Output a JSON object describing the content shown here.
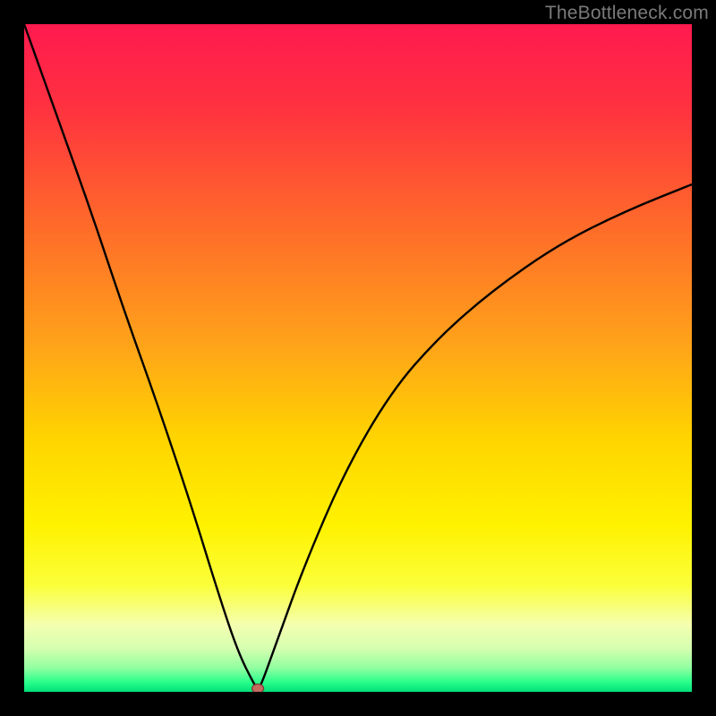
{
  "watermark": "TheBottleneck.com",
  "chart_data": {
    "type": "line",
    "title": "",
    "xlabel": "",
    "ylabel": "",
    "xlim": [
      0,
      100
    ],
    "ylim": [
      0,
      100
    ],
    "x": [
      0,
      5,
      10,
      15,
      20,
      25,
      29,
      32,
      34.5,
      35,
      35.5,
      38,
      42,
      48,
      55,
      62,
      70,
      80,
      90,
      100
    ],
    "values": [
      100,
      86,
      72,
      57,
      43,
      28,
      15,
      6,
      1,
      0.5,
      1,
      8,
      19,
      33,
      45,
      53,
      60,
      67,
      72,
      76
    ],
    "minimum_marker": {
      "x": 35,
      "y": 0.5
    },
    "gradient_stops": [
      {
        "offset": 0.0,
        "color": "#ff1a4f"
      },
      {
        "offset": 0.12,
        "color": "#ff3040"
      },
      {
        "offset": 0.3,
        "color": "#ff6a2a"
      },
      {
        "offset": 0.48,
        "color": "#ffa319"
      },
      {
        "offset": 0.62,
        "color": "#ffd400"
      },
      {
        "offset": 0.75,
        "color": "#fff200"
      },
      {
        "offset": 0.84,
        "color": "#fbff3a"
      },
      {
        "offset": 0.9,
        "color": "#f4ffb0"
      },
      {
        "offset": 0.935,
        "color": "#d6ffb0"
      },
      {
        "offset": 0.965,
        "color": "#8effa0"
      },
      {
        "offset": 0.985,
        "color": "#2bff8c"
      },
      {
        "offset": 1.0,
        "color": "#00e07a"
      }
    ]
  }
}
